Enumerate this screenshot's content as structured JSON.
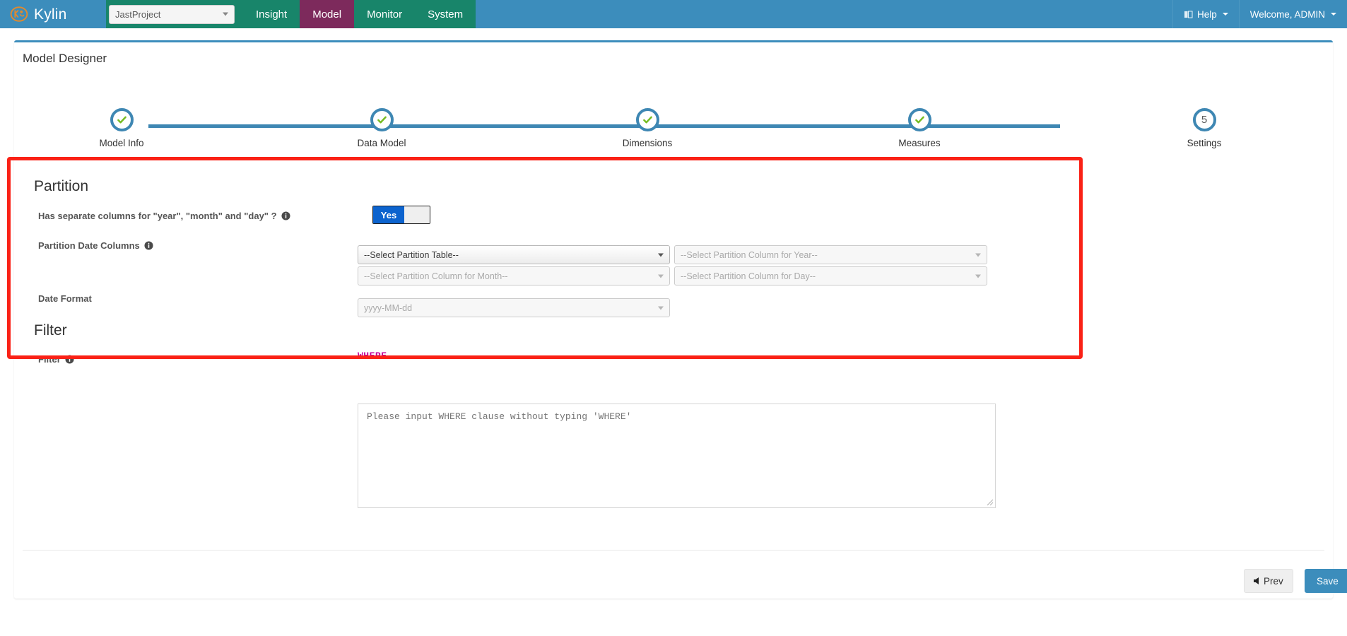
{
  "navbar": {
    "brand": "Kylin",
    "brand_logo_icon": "kylin-logo-icon",
    "project_selector": {
      "value": "JastProject",
      "icon": "chevron-down-icon"
    },
    "menu": [
      {
        "label": "Insight",
        "active": false
      },
      {
        "label": "Model",
        "active": true
      },
      {
        "label": "Monitor",
        "active": false
      },
      {
        "label": "System",
        "active": false
      }
    ],
    "right": [
      {
        "label": "Help",
        "icon": "book-icon",
        "caret": "chevron-down-icon"
      },
      {
        "label": "Welcome, ADMIN",
        "icon": "",
        "caret": "chevron-down-icon"
      }
    ],
    "colors": {
      "navbar_bg": "#3c8dbc",
      "menu_bg": "#18856a",
      "menu_active_bg": "#7d2a5c"
    }
  },
  "page": {
    "title": "Model Designer",
    "accent_top_border": "#3c8dbc"
  },
  "stepper": {
    "steps": [
      {
        "num": "1",
        "label": "Model Info",
        "state": "done",
        "icon": "check-icon"
      },
      {
        "num": "2",
        "label": "Data Model",
        "state": "done",
        "icon": "check-icon"
      },
      {
        "num": "3",
        "label": "Dimensions",
        "state": "done",
        "icon": "check-icon"
      },
      {
        "num": "4",
        "label": "Measures",
        "state": "done",
        "icon": "check-icon"
      },
      {
        "num": "5",
        "label": "Settings",
        "state": "current",
        "icon": ""
      }
    ],
    "colors": {
      "ring": "#3e87b3",
      "check": "#76bc21"
    }
  },
  "partition": {
    "title": "Partition",
    "separate_columns": {
      "label": "Has separate columns for \"year\", \"month\" and \"day\" ?",
      "info_icon": "info-icon",
      "toggle_value": "Yes",
      "toggle_color": "#0c63ce"
    },
    "date_columns": {
      "label": "Partition Date Columns",
      "info_icon": "info-icon",
      "selects": [
        {
          "value": "--Select Partition Table--",
          "enabled": true,
          "icon": "chevron-down-icon"
        },
        {
          "value": "--Select Partition Column for Year--",
          "enabled": false,
          "icon": "chevron-down-icon"
        },
        {
          "value": "--Select Partition Column for Month--",
          "enabled": false,
          "icon": "chevron-down-icon"
        },
        {
          "value": "--Select Partition Column for Day--",
          "enabled": false,
          "icon": "chevron-down-icon"
        }
      ]
    },
    "date_format": {
      "label": "Date Format",
      "value": "yyyy-MM-dd",
      "enabled": false,
      "icon": "chevron-down-icon"
    }
  },
  "filter": {
    "title": "Filter",
    "label": "Filter",
    "info_icon": "info-icon",
    "where_label": "WHERE",
    "where_label_color": "#c2009b",
    "textarea_placeholder": "Please input WHERE clause without typing 'WHERE'",
    "textarea_value": ""
  },
  "footer": {
    "prev_label": "Prev",
    "prev_icon": "arrow-left-icon",
    "save_label": "Save",
    "save_color": "#3c8dbc"
  },
  "annotation": {
    "highlight_color": "#fa2116",
    "target": "partition-section"
  }
}
